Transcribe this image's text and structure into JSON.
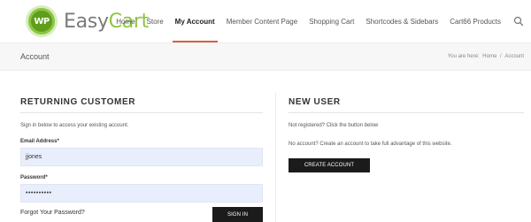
{
  "brand": {
    "logo_badge": "WP",
    "name_part1": "Easy",
    "name_part2": "Cart",
    "accent_color": "#8cc63f"
  },
  "nav": {
    "items": [
      {
        "label": "Home",
        "active": false
      },
      {
        "label": "Store",
        "active": false
      },
      {
        "label": "My Account",
        "active": true
      },
      {
        "label": "Member Content Page",
        "active": false
      },
      {
        "label": "Shopping Cart",
        "active": false
      },
      {
        "label": "Shortcodes & Sidebars",
        "active": false
      },
      {
        "label": "Cart66 Products",
        "active": false
      }
    ],
    "search_icon": "search-icon",
    "active_color": "#e05d3a"
  },
  "title_bar": {
    "title": "Account",
    "breadcrumb_prefix": "You are here:",
    "breadcrumb_home": "Home",
    "breadcrumb_sep": "/",
    "breadcrumb_current": "Account"
  },
  "returning": {
    "title": "RETURNING CUSTOMER",
    "intro": "Sign in below to access your existing account.",
    "email_label": "Email Address*",
    "email_value": "jjones",
    "password_label": "Password*",
    "password_value": "••••••••••",
    "forgot_link": "Forgot Your Password?",
    "signin_button": "SIGN IN"
  },
  "new_user": {
    "title": "NEW USER",
    "text1": "Not registered? Click the button below",
    "text2": "No account? Create an account to take full advantage of this website.",
    "create_button": "CREATE ACCOUNT"
  }
}
